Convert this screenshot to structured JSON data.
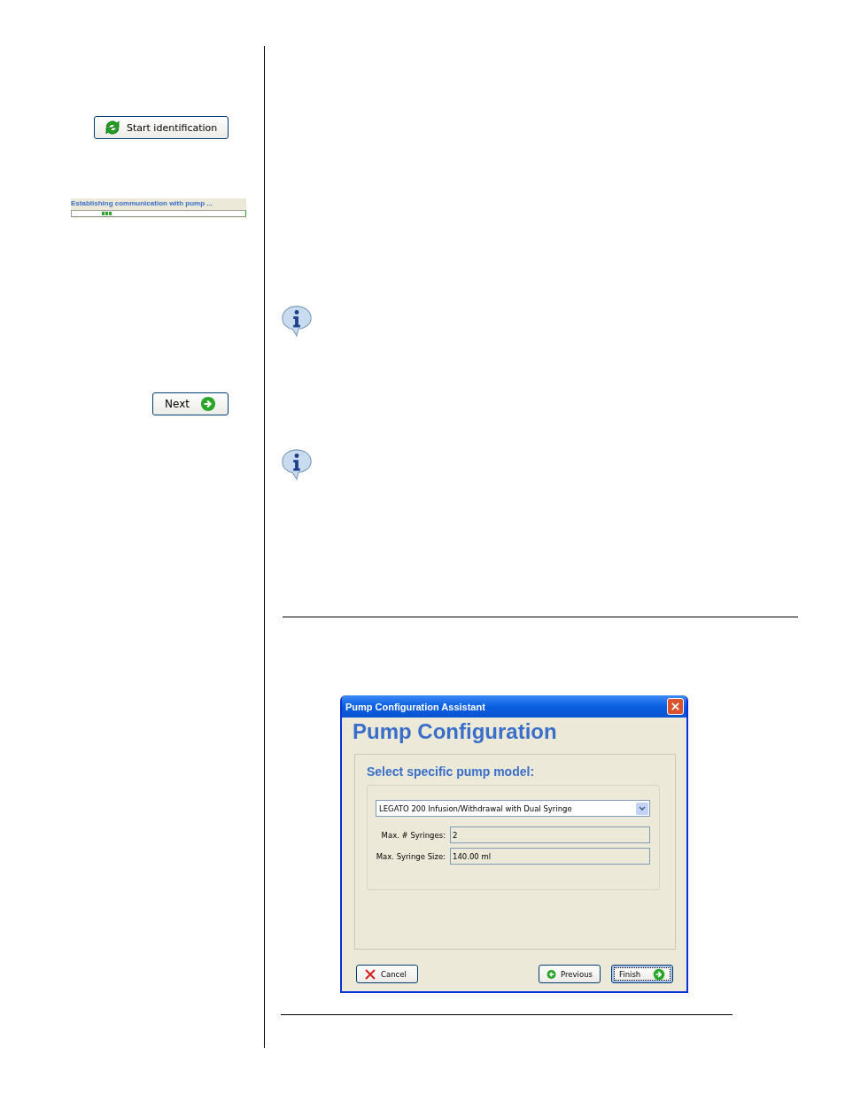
{
  "left": {
    "start_button": {
      "label": "Start identification"
    },
    "progress": {
      "caption": "Establishing communication with pump ..."
    },
    "next_button": {
      "label": "Next"
    }
  },
  "notes": [
    {
      "kind": "info"
    },
    {
      "kind": "info"
    }
  ],
  "dialog": {
    "title": "Pump Configuration Assistant",
    "heading": "Pump Configuration",
    "group_label": "Select specific pump model:",
    "model": {
      "value": "LEGATO 200 Infusion/Withdrawal with Dual Syringe"
    },
    "fields": [
      {
        "label": "Max. # Syringes:",
        "value": "2"
      },
      {
        "label": "Max. Syringe Size:",
        "value": "140.00 ml"
      }
    ],
    "buttons": [
      {
        "kind": "cancel",
        "label": "Cancel",
        "focused": false
      },
      {
        "kind": "previous",
        "label": "Previous",
        "focused": false
      },
      {
        "kind": "finish",
        "label": "Finish",
        "focused": true
      }
    ]
  }
}
